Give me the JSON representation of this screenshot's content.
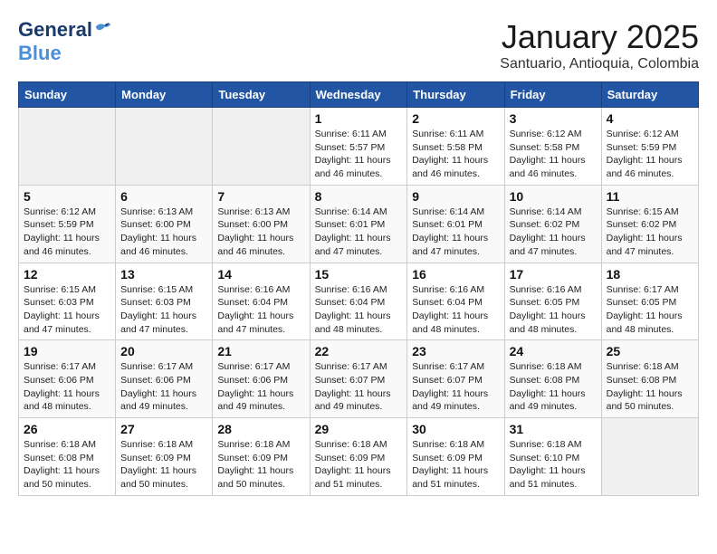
{
  "header": {
    "logo_general": "General",
    "logo_blue": "Blue",
    "month_title": "January 2025",
    "subtitle": "Santuario, Antioquia, Colombia"
  },
  "weekdays": [
    "Sunday",
    "Monday",
    "Tuesday",
    "Wednesday",
    "Thursday",
    "Friday",
    "Saturday"
  ],
  "weeks": [
    [
      {
        "day": "",
        "info": ""
      },
      {
        "day": "",
        "info": ""
      },
      {
        "day": "",
        "info": ""
      },
      {
        "day": "1",
        "info": "Sunrise: 6:11 AM\nSunset: 5:57 PM\nDaylight: 11 hours\nand 46 minutes."
      },
      {
        "day": "2",
        "info": "Sunrise: 6:11 AM\nSunset: 5:58 PM\nDaylight: 11 hours\nand 46 minutes."
      },
      {
        "day": "3",
        "info": "Sunrise: 6:12 AM\nSunset: 5:58 PM\nDaylight: 11 hours\nand 46 minutes."
      },
      {
        "day": "4",
        "info": "Sunrise: 6:12 AM\nSunset: 5:59 PM\nDaylight: 11 hours\nand 46 minutes."
      }
    ],
    [
      {
        "day": "5",
        "info": "Sunrise: 6:12 AM\nSunset: 5:59 PM\nDaylight: 11 hours\nand 46 minutes."
      },
      {
        "day": "6",
        "info": "Sunrise: 6:13 AM\nSunset: 6:00 PM\nDaylight: 11 hours\nand 46 minutes."
      },
      {
        "day": "7",
        "info": "Sunrise: 6:13 AM\nSunset: 6:00 PM\nDaylight: 11 hours\nand 46 minutes."
      },
      {
        "day": "8",
        "info": "Sunrise: 6:14 AM\nSunset: 6:01 PM\nDaylight: 11 hours\nand 47 minutes."
      },
      {
        "day": "9",
        "info": "Sunrise: 6:14 AM\nSunset: 6:01 PM\nDaylight: 11 hours\nand 47 minutes."
      },
      {
        "day": "10",
        "info": "Sunrise: 6:14 AM\nSunset: 6:02 PM\nDaylight: 11 hours\nand 47 minutes."
      },
      {
        "day": "11",
        "info": "Sunrise: 6:15 AM\nSunset: 6:02 PM\nDaylight: 11 hours\nand 47 minutes."
      }
    ],
    [
      {
        "day": "12",
        "info": "Sunrise: 6:15 AM\nSunset: 6:03 PM\nDaylight: 11 hours\nand 47 minutes."
      },
      {
        "day": "13",
        "info": "Sunrise: 6:15 AM\nSunset: 6:03 PM\nDaylight: 11 hours\nand 47 minutes."
      },
      {
        "day": "14",
        "info": "Sunrise: 6:16 AM\nSunset: 6:04 PM\nDaylight: 11 hours\nand 47 minutes."
      },
      {
        "day": "15",
        "info": "Sunrise: 6:16 AM\nSunset: 6:04 PM\nDaylight: 11 hours\nand 48 minutes."
      },
      {
        "day": "16",
        "info": "Sunrise: 6:16 AM\nSunset: 6:04 PM\nDaylight: 11 hours\nand 48 minutes."
      },
      {
        "day": "17",
        "info": "Sunrise: 6:16 AM\nSunset: 6:05 PM\nDaylight: 11 hours\nand 48 minutes."
      },
      {
        "day": "18",
        "info": "Sunrise: 6:17 AM\nSunset: 6:05 PM\nDaylight: 11 hours\nand 48 minutes."
      }
    ],
    [
      {
        "day": "19",
        "info": "Sunrise: 6:17 AM\nSunset: 6:06 PM\nDaylight: 11 hours\nand 48 minutes."
      },
      {
        "day": "20",
        "info": "Sunrise: 6:17 AM\nSunset: 6:06 PM\nDaylight: 11 hours\nand 49 minutes."
      },
      {
        "day": "21",
        "info": "Sunrise: 6:17 AM\nSunset: 6:06 PM\nDaylight: 11 hours\nand 49 minutes."
      },
      {
        "day": "22",
        "info": "Sunrise: 6:17 AM\nSunset: 6:07 PM\nDaylight: 11 hours\nand 49 minutes."
      },
      {
        "day": "23",
        "info": "Sunrise: 6:17 AM\nSunset: 6:07 PM\nDaylight: 11 hours\nand 49 minutes."
      },
      {
        "day": "24",
        "info": "Sunrise: 6:18 AM\nSunset: 6:08 PM\nDaylight: 11 hours\nand 49 minutes."
      },
      {
        "day": "25",
        "info": "Sunrise: 6:18 AM\nSunset: 6:08 PM\nDaylight: 11 hours\nand 50 minutes."
      }
    ],
    [
      {
        "day": "26",
        "info": "Sunrise: 6:18 AM\nSunset: 6:08 PM\nDaylight: 11 hours\nand 50 minutes."
      },
      {
        "day": "27",
        "info": "Sunrise: 6:18 AM\nSunset: 6:09 PM\nDaylight: 11 hours\nand 50 minutes."
      },
      {
        "day": "28",
        "info": "Sunrise: 6:18 AM\nSunset: 6:09 PM\nDaylight: 11 hours\nand 50 minutes."
      },
      {
        "day": "29",
        "info": "Sunrise: 6:18 AM\nSunset: 6:09 PM\nDaylight: 11 hours\nand 51 minutes."
      },
      {
        "day": "30",
        "info": "Sunrise: 6:18 AM\nSunset: 6:09 PM\nDaylight: 11 hours\nand 51 minutes."
      },
      {
        "day": "31",
        "info": "Sunrise: 6:18 AM\nSunset: 6:10 PM\nDaylight: 11 hours\nand 51 minutes."
      },
      {
        "day": "",
        "info": ""
      }
    ]
  ]
}
